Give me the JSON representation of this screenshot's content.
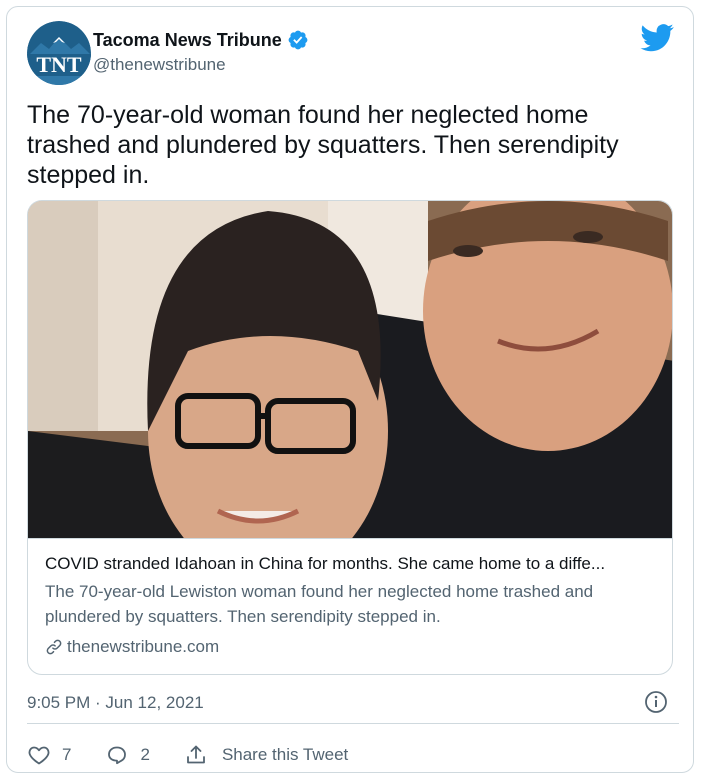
{
  "tweet": {
    "author": {
      "display_name": "Tacoma News Tribune",
      "handle": "@thenewstribune",
      "avatar_text": "TNT",
      "verified": true
    },
    "text": "The 70-year-old woman found her neglected home trashed and plundered by squatters. Then serendipity stepped in.",
    "link_card": {
      "title": "COVID stranded Idahoan in China for months. She came home to a diffe...",
      "description": "The 70-year-old Lewiston woman found her neglected home trashed and plundered by squatters. Then serendipity stepped in.",
      "domain": "thenewstribune.com",
      "image_description": "selfie-of-woman-with-glasses-and-smiling-man"
    },
    "timestamp": "9:05 PM · Jun 12, 2021",
    "actions": {
      "likes": "7",
      "replies": "2",
      "share_label": "Share this Tweet"
    }
  },
  "icons": {
    "brand": "twitter-bird-icon",
    "verified": "verified-badge-icon",
    "info": "info-icon",
    "like": "heart-icon",
    "reply": "reply-bubble-icon",
    "share": "share-icon",
    "link": "link-icon"
  },
  "colors": {
    "brand_blue": "#1d9bf0",
    "text_primary": "#0f1419",
    "text_secondary": "#536471",
    "border": "#cfd9de",
    "avatar_bg": "#1e5f8a"
  }
}
